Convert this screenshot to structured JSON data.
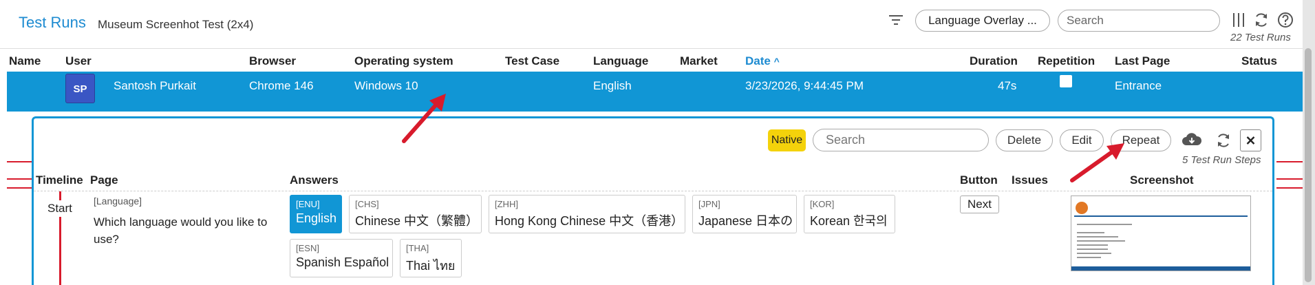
{
  "header": {
    "title": "Test Runs",
    "subtitle": "Museum Screenhot Test (2x4)",
    "overlay_button": "Language Overlay ...",
    "search_placeholder": "Search",
    "runs_count": "22 Test Runs"
  },
  "table": {
    "columns": [
      "Name",
      "User",
      "Browser",
      "Operating system",
      "Test Case",
      "Language",
      "Market",
      "Date",
      "Duration",
      "Repetition",
      "Last Page",
      "Status"
    ],
    "sort_indicator": "^",
    "selected_row": {
      "avatar": "SP",
      "user": "Santosh Purkait",
      "browser": "Chrome 146",
      "os": "Windows 10",
      "language": "English",
      "date": "3/23/2026, 9:44:45 PM",
      "duration": "47s",
      "last_page": "Entrance"
    }
  },
  "detail": {
    "native_badge": "Native",
    "search_placeholder": "Search",
    "delete_label": "Delete",
    "edit_label": "Edit",
    "repeat_label": "Repeat",
    "steps_count": "5 Test Run Steps",
    "columns": {
      "timeline": "Timeline",
      "page": "Page",
      "answers": "Answers",
      "button": "Button",
      "issues": "Issues",
      "screenshot": "Screenshot"
    },
    "step": {
      "timeline": "Start",
      "page_tag": "[Language]",
      "question": "Which language would you like to use?",
      "button": "Next",
      "answers": [
        {
          "code": "[ENU]",
          "text": "English",
          "selected": true
        },
        {
          "code": "[CHS]",
          "text": "Chinese 中文（繁體）"
        },
        {
          "code": "[ZHH]",
          "text": "Hong Kong Chinese 中文（香港）"
        },
        {
          "code": "[JPN]",
          "text": "Japanese 日本の"
        },
        {
          "code": "[KOR]",
          "text": "Korean 한국의"
        },
        {
          "code": "[ESN]",
          "text": "Spanish Español"
        },
        {
          "code": "[THA]",
          "text": "Thai ไทย"
        }
      ]
    }
  },
  "colors": {
    "accent": "#1196d5",
    "title_blue": "#1d8bd1",
    "native_badge": "#f4d20b",
    "avatar": "#3a56c4",
    "annotation_red": "#d81b2c"
  }
}
